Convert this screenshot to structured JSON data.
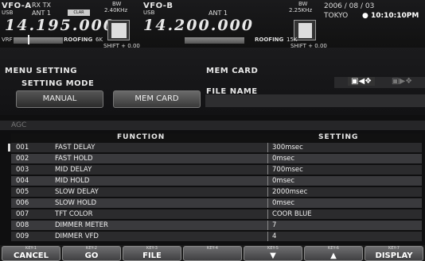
{
  "vfo_a": {
    "label": "VFO-A",
    "mode": "RX TX",
    "sub": "USB",
    "ant": "ANT 1",
    "clar": "CLAR",
    "bw_label": "BW",
    "bw": "2.40KHz",
    "freq": "14.195.000",
    "vrf": "VRF",
    "roofing": "ROOFING",
    "roofing_val": "6K",
    "shift": "SHIFT + 0.00"
  },
  "vfo_b": {
    "label": "VFO-B",
    "sub": "USB",
    "ant": "ANT 1",
    "bw_label": "BW",
    "bw": "2.25KHz",
    "freq": "14.200.000",
    "roofing": "ROOFING",
    "roofing_val": "15K",
    "shift": "SHIFT + 0.00"
  },
  "clock": {
    "date": "2006 / 08 / 03",
    "city": "TOKYO",
    "time": "● 10:10:10PM"
  },
  "menu": {
    "title": "MENU SETTING",
    "mode_label": "SETTING MODE",
    "manual": "MANUAL",
    "memcard": "MEM CARD"
  },
  "memcard": {
    "title": "MEM CARD",
    "file_name": "FILE NAME",
    "load_icon": "save-to-card-icon",
    "save_icon": "load-from-card-icon"
  },
  "group": "AGC",
  "table": {
    "col_function": "FUNCTION",
    "col_setting": "SETTING",
    "rows": [
      {
        "no": "001",
        "function": "FAST DELAY",
        "setting": "300msec"
      },
      {
        "no": "002",
        "function": "FAST HOLD",
        "setting": "0msec"
      },
      {
        "no": "003",
        "function": "MID DELAY",
        "setting": "700msec"
      },
      {
        "no": "004",
        "function": "MID HOLD",
        "setting": "0msec"
      },
      {
        "no": "005",
        "function": "SLOW DELAY",
        "setting": "2000msec"
      },
      {
        "no": "006",
        "function": "SLOW HOLD",
        "setting": "0msec"
      },
      {
        "no": "007",
        "function": "TFT COLOR",
        "setting": "COOR BLUE"
      },
      {
        "no": "008",
        "function": "DIMMER METER",
        "setting": "7"
      },
      {
        "no": "009",
        "function": "DIMMER VFD",
        "setting": "4"
      }
    ]
  },
  "fkeys": [
    {
      "key": "KEY-1",
      "label": "CANCEL"
    },
    {
      "key": "KEY-2",
      "label": "GO"
    },
    {
      "key": "KEY-3",
      "label": "FILE"
    },
    {
      "key": "KEY-4",
      "label": ""
    },
    {
      "key": "KEY-5",
      "label": "▼"
    },
    {
      "key": "KEY-6",
      "label": "▲"
    },
    {
      "key": "KEY-7",
      "label": "DISPLAY"
    }
  ]
}
